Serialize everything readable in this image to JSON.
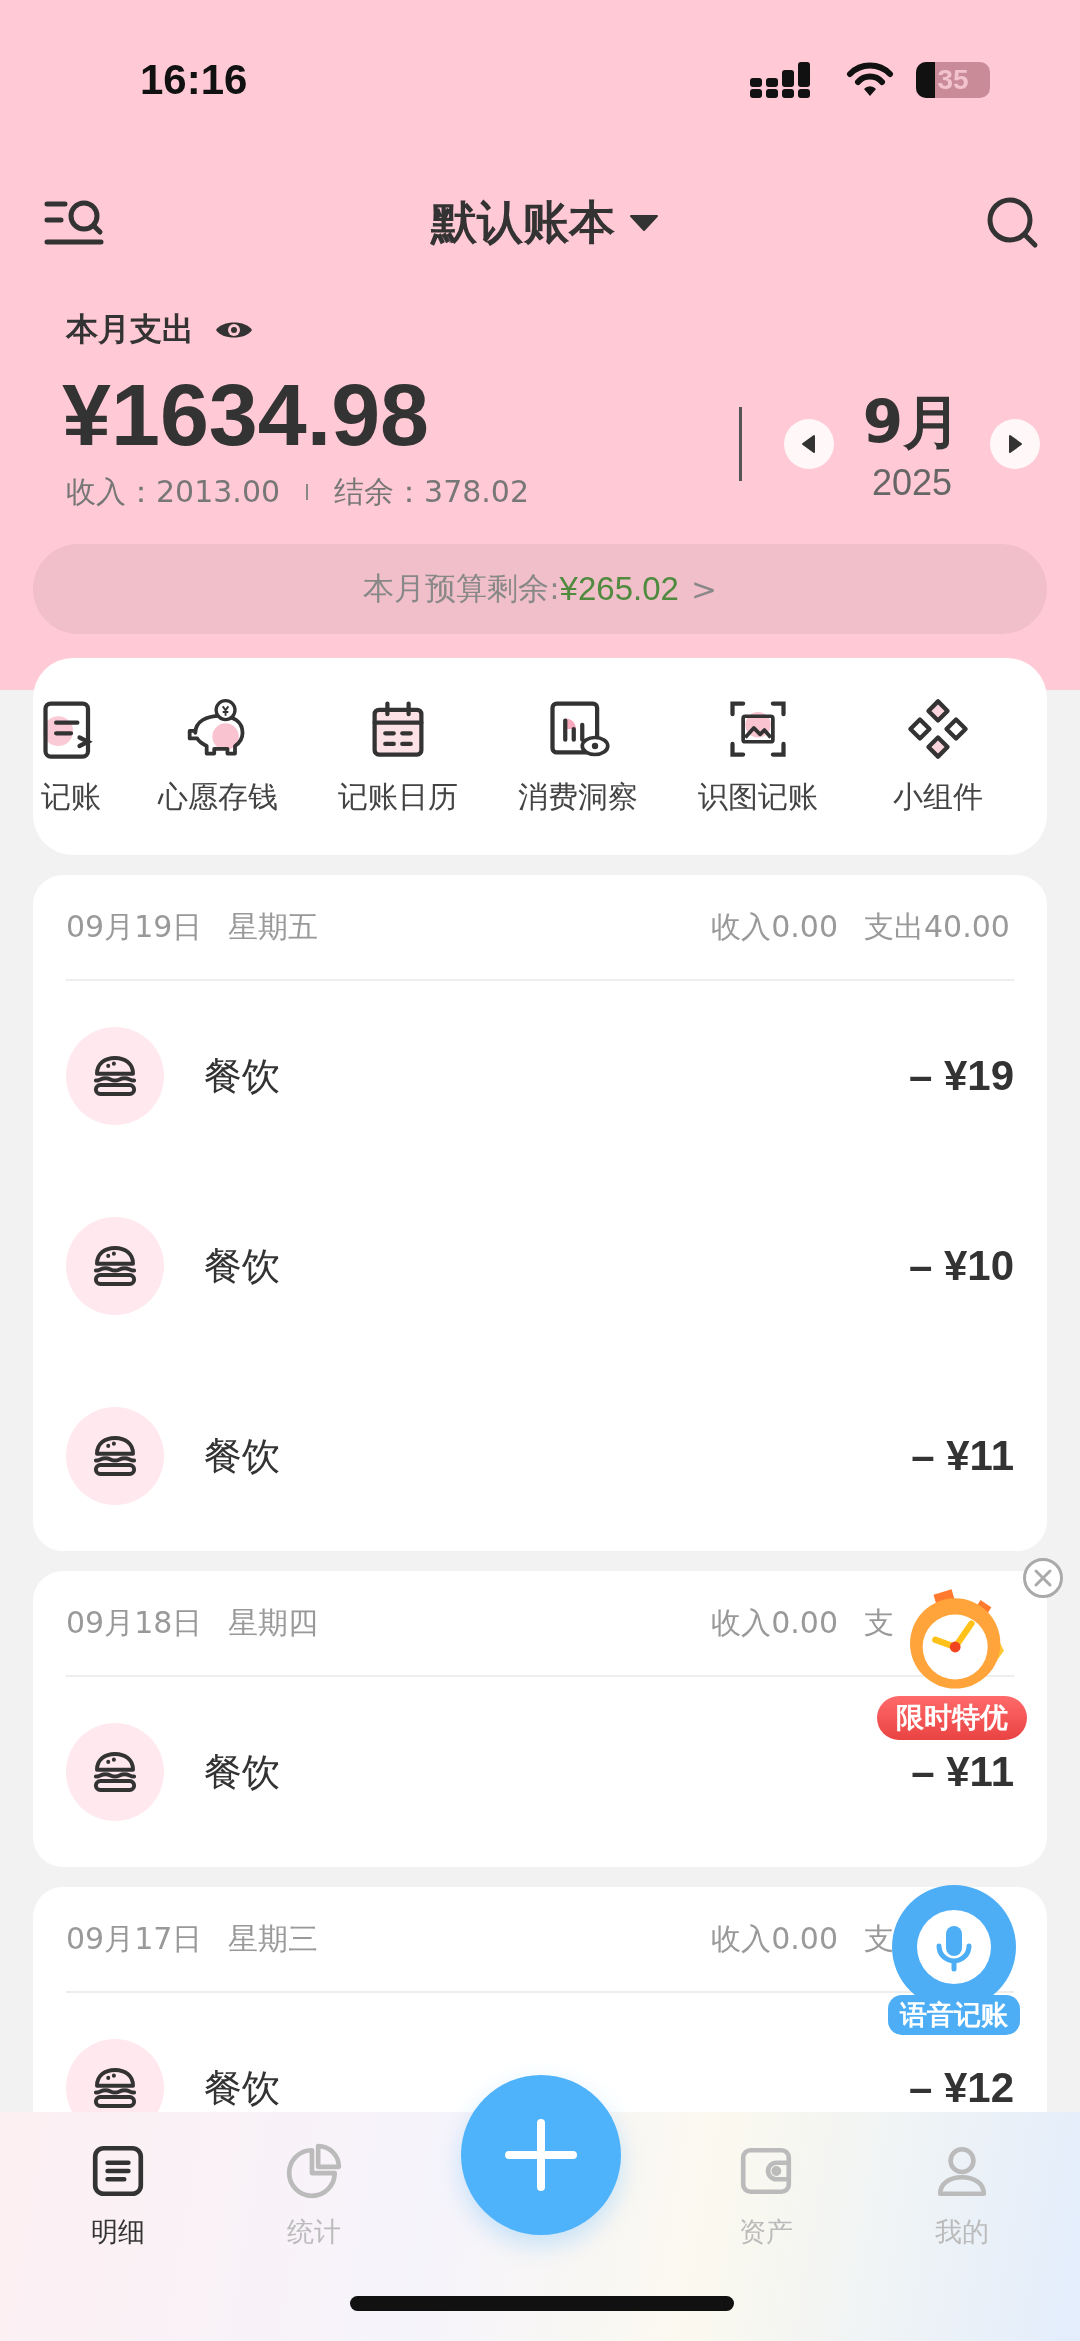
{
  "status_bar": {
    "time": "16:16",
    "battery": "35"
  },
  "header": {
    "title": "默认账本"
  },
  "summary": {
    "label": "本月支出",
    "amount": "¥1634.98",
    "income": "收入：2013.00",
    "balance": "结余：378.02",
    "month": "9月",
    "year": "2025"
  },
  "budget": {
    "label": "本月预算剩余: ",
    "value": "¥265.02",
    "arrow": ">"
  },
  "shortcuts": [
    {
      "label": "记账",
      "kind": "transfer"
    },
    {
      "label": "心愿存钱",
      "kind": "piggybank"
    },
    {
      "label": "记账日历",
      "kind": "calendar"
    },
    {
      "label": "消费洞察",
      "kind": "insight"
    },
    {
      "label": "识图记账",
      "kind": "scan"
    },
    {
      "label": "小组件",
      "kind": "widget"
    }
  ],
  "groups": [
    {
      "date": "09月19日",
      "weekday": "星期五",
      "income": "收入0.00",
      "expense": "支出40.00",
      "entries": [
        {
          "category": "餐饮",
          "amount": "– ¥19"
        },
        {
          "category": "餐饮",
          "amount": "– ¥10"
        },
        {
          "category": "餐饮",
          "amount": "– ¥11"
        }
      ]
    },
    {
      "date": "09月18日",
      "weekday": "星期四",
      "income": "收入0.00",
      "expense": "支",
      "entries": [
        {
          "category": "餐饮",
          "amount": "– ¥11"
        }
      ]
    },
    {
      "date": "09月17日",
      "weekday": "星期三",
      "income": "收入0.00",
      "expense": "支",
      "entries": [
        {
          "category": "餐饮",
          "amount": "– ¥12"
        }
      ]
    }
  ],
  "promo": {
    "label": "限时特优"
  },
  "voice": {
    "label": "语音记账"
  },
  "nav": [
    {
      "label": "明细",
      "kind": "list",
      "selected": true
    },
    {
      "label": "统计",
      "kind": "pie",
      "selected": false
    },
    {
      "label": "资产",
      "kind": "wallet",
      "selected": false
    },
    {
      "label": "我的",
      "kind": "person",
      "selected": false
    }
  ]
}
